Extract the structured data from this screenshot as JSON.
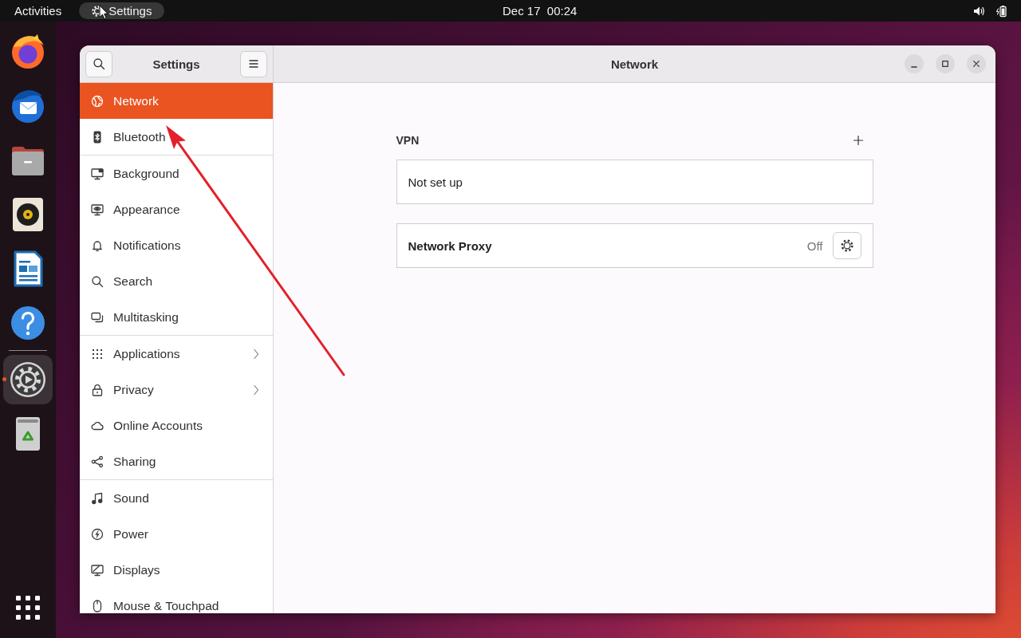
{
  "top_bar": {
    "activities": "Activities",
    "app_menu": "Settings",
    "clock": "Dec 17  00:24"
  },
  "dock": {
    "apps": [
      {
        "running": false,
        "selected": false
      },
      {
        "running": false,
        "selected": false
      },
      {
        "running": false,
        "selected": false
      },
      {
        "running": false,
        "selected": false
      },
      {
        "running": false,
        "selected": false
      },
      {
        "running": false,
        "selected": false
      },
      {
        "running": true,
        "selected": true
      },
      {
        "running": false,
        "selected": false
      }
    ]
  },
  "window": {
    "title": "Network",
    "sidebar": {
      "title": "Settings",
      "groups": [
        {
          "items": [
            {
              "label": "Network",
              "selected": true,
              "submenu": false
            },
            {
              "label": "Bluetooth",
              "selected": false,
              "submenu": false
            }
          ]
        },
        {
          "items": [
            {
              "label": "Background",
              "selected": false,
              "submenu": false
            },
            {
              "label": "Appearance",
              "selected": false,
              "submenu": false
            },
            {
              "label": "Notifications",
              "selected": false,
              "submenu": false
            },
            {
              "label": "Search",
              "selected": false,
              "submenu": false
            },
            {
              "label": "Multitasking",
              "selected": false,
              "submenu": false
            }
          ]
        },
        {
          "items": [
            {
              "label": "Applications",
              "selected": false,
              "submenu": true
            },
            {
              "label": "Privacy",
              "selected": false,
              "submenu": true
            },
            {
              "label": "Online Accounts",
              "selected": false,
              "submenu": false
            },
            {
              "label": "Sharing",
              "selected": false,
              "submenu": false
            }
          ]
        },
        {
          "items": [
            {
              "label": "Sound",
              "selected": false,
              "submenu": false
            },
            {
              "label": "Power",
              "selected": false,
              "submenu": false
            },
            {
              "label": "Displays",
              "selected": false,
              "submenu": false
            },
            {
              "label": "Mouse & Touchpad",
              "selected": false,
              "submenu": false
            }
          ]
        }
      ]
    },
    "vpn": {
      "heading": "VPN",
      "status": "Not set up"
    },
    "proxy": {
      "label": "Network Proxy",
      "value": "Off"
    }
  }
}
